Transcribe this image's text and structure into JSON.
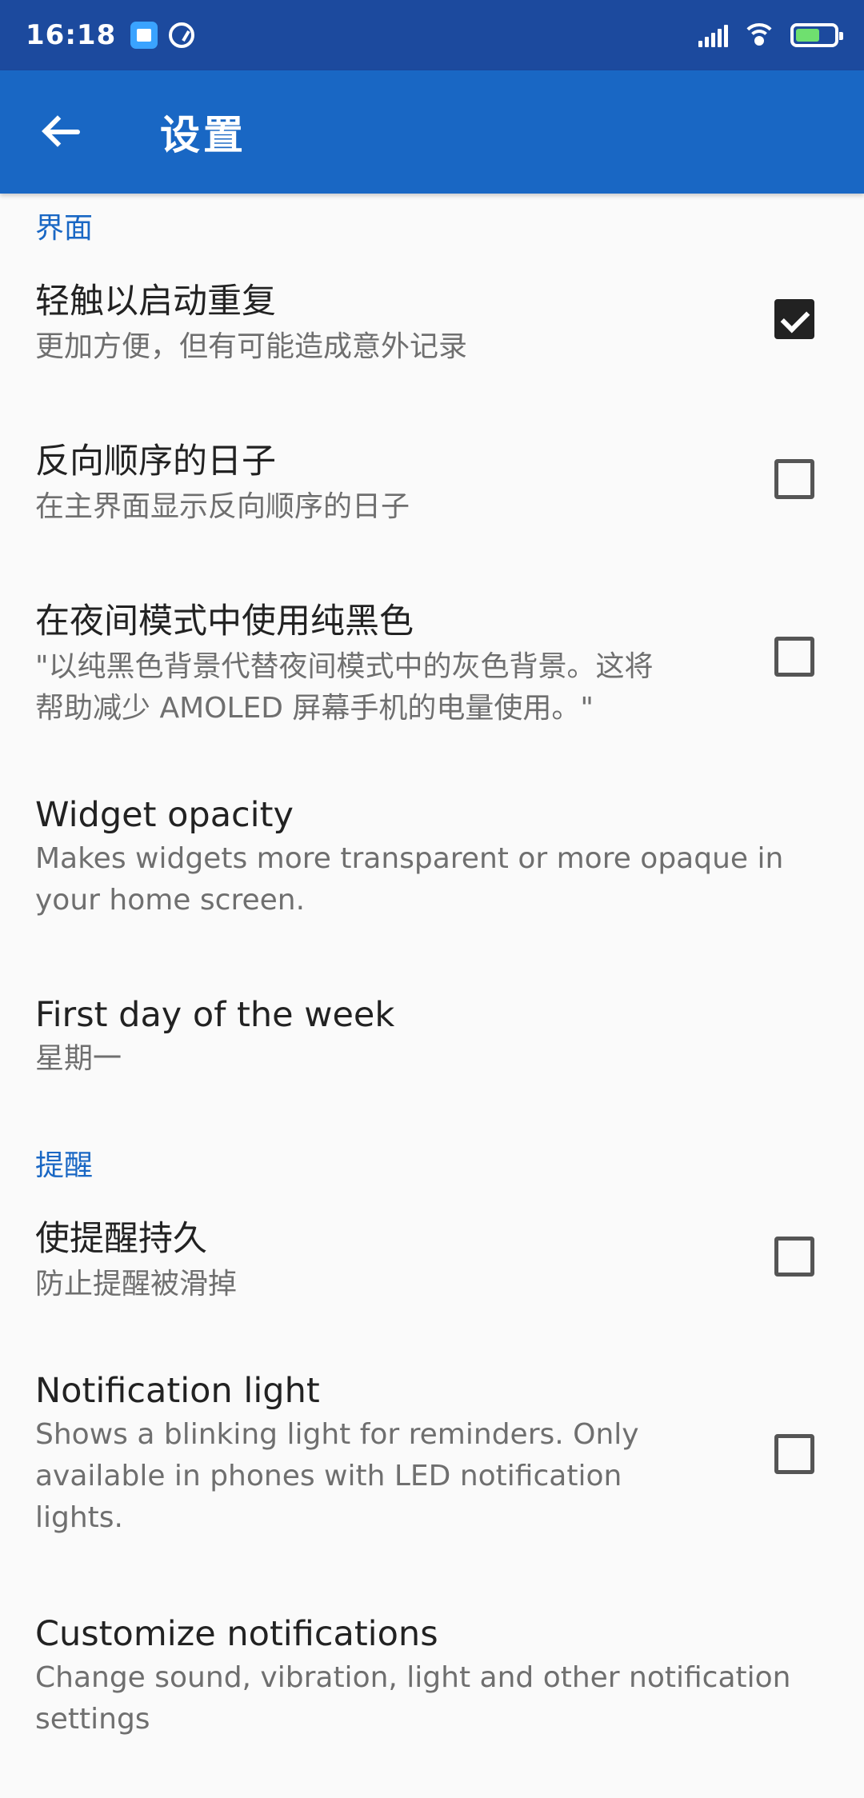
{
  "status_bar": {
    "time": "16:18"
  },
  "app_bar": {
    "title": "设置"
  },
  "sections": {
    "interface": {
      "header": "界面"
    },
    "reminders": {
      "header": "提醒"
    }
  },
  "prefs": {
    "tap_to_repeat": {
      "title": "轻触以启动重复",
      "summary": "更加方便，但有可能造成意外记录",
      "checked": true
    },
    "reverse_days": {
      "title": "反向顺序的日子",
      "summary": "在主界面显示反向顺序的日子",
      "checked": false
    },
    "pure_black": {
      "title": "在夜间模式中使用纯黑色",
      "summary_line1": "\"以纯黑色背景代替夜间模式中的灰色背景。这将",
      "summary_line2": "帮助减少 AMOLED 屏幕手机的电量使用。\"",
      "checked": false
    },
    "widget_opacity": {
      "title": "Widget opacity",
      "summary_line1": "Makes widgets more transparent or more opaque in",
      "summary_line2": "your home screen."
    },
    "first_day": {
      "title": "First day of the week",
      "summary": "星期一"
    },
    "sticky_reminders": {
      "title": "使提醒持久",
      "summary": "防止提醒被滑掉",
      "checked": false
    },
    "notification_light": {
      "title": "Notification light",
      "summary_line1": "Shows a blinking light for reminders. Only",
      "summary_line2": "available in phones with LED notification",
      "summary_line3": "lights.",
      "checked": false
    },
    "customize_notifications": {
      "title": "Customize notifications",
      "summary_line1": "Change sound, vibration, light and other notification",
      "summary_line2": "settings"
    }
  }
}
